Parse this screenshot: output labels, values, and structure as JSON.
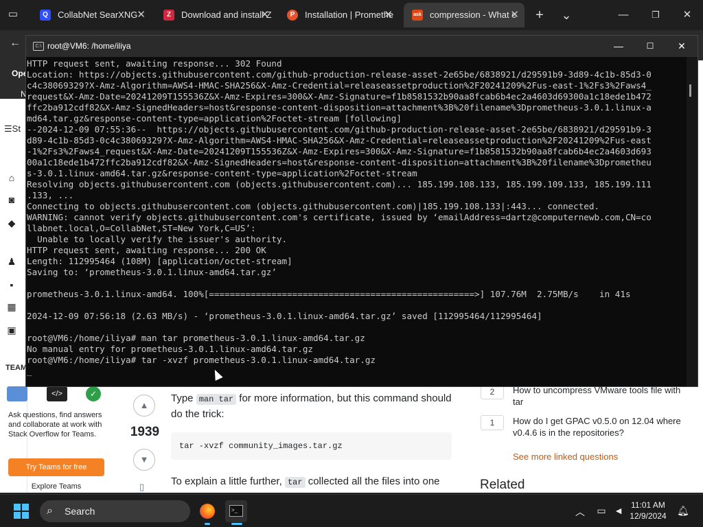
{
  "browser": {
    "tabs": [
      {
        "label": "CollabNet SearXNG",
        "favicon": "searx-icon",
        "color": "#3050ff",
        "glyph": "Q"
      },
      {
        "label": "Download and install Z",
        "favicon": "z-icon",
        "color": "#d0283c",
        "glyph": "Z"
      },
      {
        "label": "Installation | Promethe",
        "favicon": "prometheus-icon",
        "color": "#e6522c",
        "glyph": "P"
      },
      {
        "label": "compression - What c",
        "favicon": "askubuntu-icon",
        "color": "#dd4814",
        "glyph": "ask"
      }
    ],
    "new_tab_glyph": "+",
    "tab_list_glyph": "⌄"
  },
  "page": {
    "sidebar_fragments": {
      "ope": "Ope",
      "n": "N",
      "st": "St",
      "teams_title": "TEAMS"
    },
    "teams": {
      "desc": "Ask questions, find answers and collaborate at work with Stack Overflow for Teams.",
      "try_button": "Try Teams for free",
      "explore": "Explore Teams"
    },
    "answer": {
      "score": "1939",
      "p1_before": "Type ",
      "p1_code": "man tar",
      "p1_after": " for more information, but this command should do the trick:",
      "code": "tar -xvzf community_images.tar.gz",
      "p2_before": "To explain a little further, ",
      "p2_code": "tar",
      "p2_after": " collected all the files into one"
    },
    "linked": [
      {
        "count": "2",
        "title": "How to uncompress VMware tools file with tar"
      },
      {
        "count": "1",
        "title": "How do I get GPAC v0.5.0 on 12.04 where v0.4.6 is in the repositories?"
      }
    ],
    "see_more": "See more linked questions",
    "related": "Related"
  },
  "terminal": {
    "title": "root@VM6: /home/iliya",
    "lines": [
      "HTTP request sent, awaiting response... 302 Found",
      "Location: https://objects.githubusercontent.com/github-production-release-asset-2e65be/6838921/d29591b9-3d89-4c1b-85d3-0",
      "c4c38069329?X-Amz-Algorithm=AWS4-HMAC-SHA256&X-Amz-Credential=releaseassetproduction%2F20241209%2Fus-east-1%2Fs3%2Faws4_",
      "request&X-Amz-Date=20241209T155536Z&X-Amz-Expires=300&X-Amz-Signature=f1b8581532b90aa8fcab6b4ec2a4603d69300a1c18ede1b472",
      "ffc2ba912cdf82&X-Amz-SignedHeaders=host&response-content-disposition=attachment%3B%20filename%3Dprometheus-3.0.1.linux-a",
      "md64.tar.gz&response-content-type=application%2Foctet-stream [following]",
      "--2024-12-09 07:55:36--  https://objects.githubusercontent.com/github-production-release-asset-2e65be/6838921/d29591b9-3",
      "d89-4c1b-85d3-0c4c38069329?X-Amz-Algorithm=AWS4-HMAC-SHA256&X-Amz-Credential=releaseassetproduction%2F20241209%2Fus-east",
      "-1%2Fs3%2Faws4_request&X-Amz-Date=20241209T155536Z&X-Amz-Expires=300&X-Amz-Signature=f1b8581532b90aa8fcab6b4ec2a4603d693",
      "00a1c18ede1b472ffc2ba912cdf82&X-Amz-SignedHeaders=host&response-content-disposition=attachment%3B%20filename%3Dprometheu",
      "s-3.0.1.linux-amd64.tar.gz&response-content-type=application%2Foctet-stream",
      "Resolving objects.githubusercontent.com (objects.githubusercontent.com)... 185.199.108.133, 185.199.109.133, 185.199.111",
      ".133, ...",
      "Connecting to objects.githubusercontent.com (objects.githubusercontent.com)|185.199.108.133|:443... connected.",
      "WARNING: cannot verify objects.githubusercontent.com's certificate, issued by ‘emailAddress=dartz@computernewb.com,CN=co",
      "llabnet.local,O=CollabNet,ST=New York,C=US’:",
      "  Unable to locally verify the issuer's authority.",
      "HTTP request sent, awaiting response... 200 OK",
      "Length: 112995464 (108M) [application/octet-stream]",
      "Saving to: ‘prometheus-3.0.1.linux-amd64.tar.gz’",
      "",
      "prometheus-3.0.1.linux-amd64. 100%[===================================================>] 107.76M  2.75MB/s    in 41s",
      "",
      "2024-12-09 07:56:18 (2.63 MB/s) - ‘prometheus-3.0.1.linux-amd64.tar.gz’ saved [112995464/112995464]",
      "",
      "root@VM6:/home/iliya# man tar prometheus-3.0.1.linux-amd64.tar.gz",
      "No manual entry for prometheus-3.0.1.linux-amd64.tar.gz",
      "root@VM6:/home/iliya# tar -xvzf prometheus-3.0.1.linux-amd64.tar.gz",
      "_"
    ]
  },
  "taskbar": {
    "search_placeholder": "Search",
    "clock_time": "11:01 AM",
    "clock_date": "12/9/2024",
    "accent": "#4cc2ff"
  }
}
